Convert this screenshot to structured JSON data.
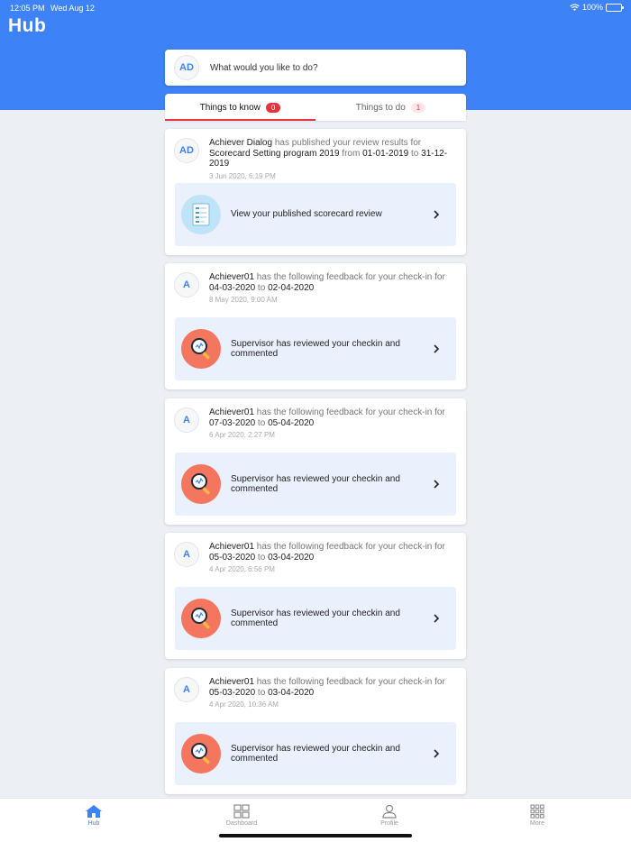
{
  "status_bar": {
    "time": "12:05 PM",
    "date": "Wed Aug 12",
    "battery": "100%"
  },
  "header": {
    "title": "Hub"
  },
  "search": {
    "avatar": "AD",
    "prompt": "What would you like to do?"
  },
  "tabs": [
    {
      "label": "Things to know",
      "count": "0",
      "active": true
    },
    {
      "label": "Things to do",
      "count": "1",
      "active": false
    }
  ],
  "cards": [
    {
      "avatar": "AD",
      "actor": "Achiever Dialog",
      "verb": " has published your review results for ",
      "subject": "Scorecard Setting program 2019",
      "from_word": " from ",
      "start": "01-01-2019",
      "to_word": " to ",
      "end": "31-12-2019",
      "timestamp": "3 Jun 2020, 6:19 PM",
      "action_text": "View your published scorecard review",
      "icon": "scorecard-icon"
    },
    {
      "avatar": "A",
      "actor": "Achiever01",
      "verb": " has the following feedback for your check-in for ",
      "subject": "",
      "from_word": "",
      "start": "04-03-2020",
      "to_word": " to ",
      "end": "02-04-2020",
      "timestamp": "8 May 2020, 9:00 AM",
      "action_text": "Supervisor has reviewed your checkin and commented",
      "icon": "magnifier-icon"
    },
    {
      "avatar": "A",
      "actor": "Achiever01",
      "verb": " has the following feedback for your check-in for ",
      "subject": "",
      "from_word": "",
      "start": "07-03-2020",
      "to_word": " to ",
      "end": "05-04-2020",
      "timestamp": "6 Apr 2020, 2:27 PM",
      "action_text": "Supervisor has reviewed your checkin and commented",
      "icon": "magnifier-icon"
    },
    {
      "avatar": "A",
      "actor": "Achiever01",
      "verb": " has the following feedback for your check-in for ",
      "subject": "",
      "from_word": "",
      "start": "05-03-2020",
      "to_word": " to ",
      "end": "03-04-2020",
      "timestamp": "4 Apr 2020, 6:56 PM",
      "action_text": "Supervisor has reviewed your checkin and commented",
      "icon": "magnifier-icon"
    },
    {
      "avatar": "A",
      "actor": "Achiever01",
      "verb": " has the following feedback for your check-in for ",
      "subject": "",
      "from_word": "",
      "start": "05-03-2020",
      "to_word": " to ",
      "end": "03-04-2020",
      "timestamp": "4 Apr 2020, 10:36 AM",
      "action_text": "Supervisor has reviewed your checkin and commented",
      "icon": "magnifier-icon"
    }
  ],
  "nav": [
    {
      "label": "Hub",
      "icon": "home-icon",
      "active": true
    },
    {
      "label": "Dashboard",
      "icon": "dashboard-icon",
      "active": false
    },
    {
      "label": "Profile",
      "icon": "person-icon",
      "active": false
    },
    {
      "label": "More",
      "icon": "grid-icon",
      "active": false
    }
  ],
  "colors": {
    "brand": "#3d82f6",
    "badge": "#e8323c",
    "action_bg": "#eaf0fc"
  }
}
